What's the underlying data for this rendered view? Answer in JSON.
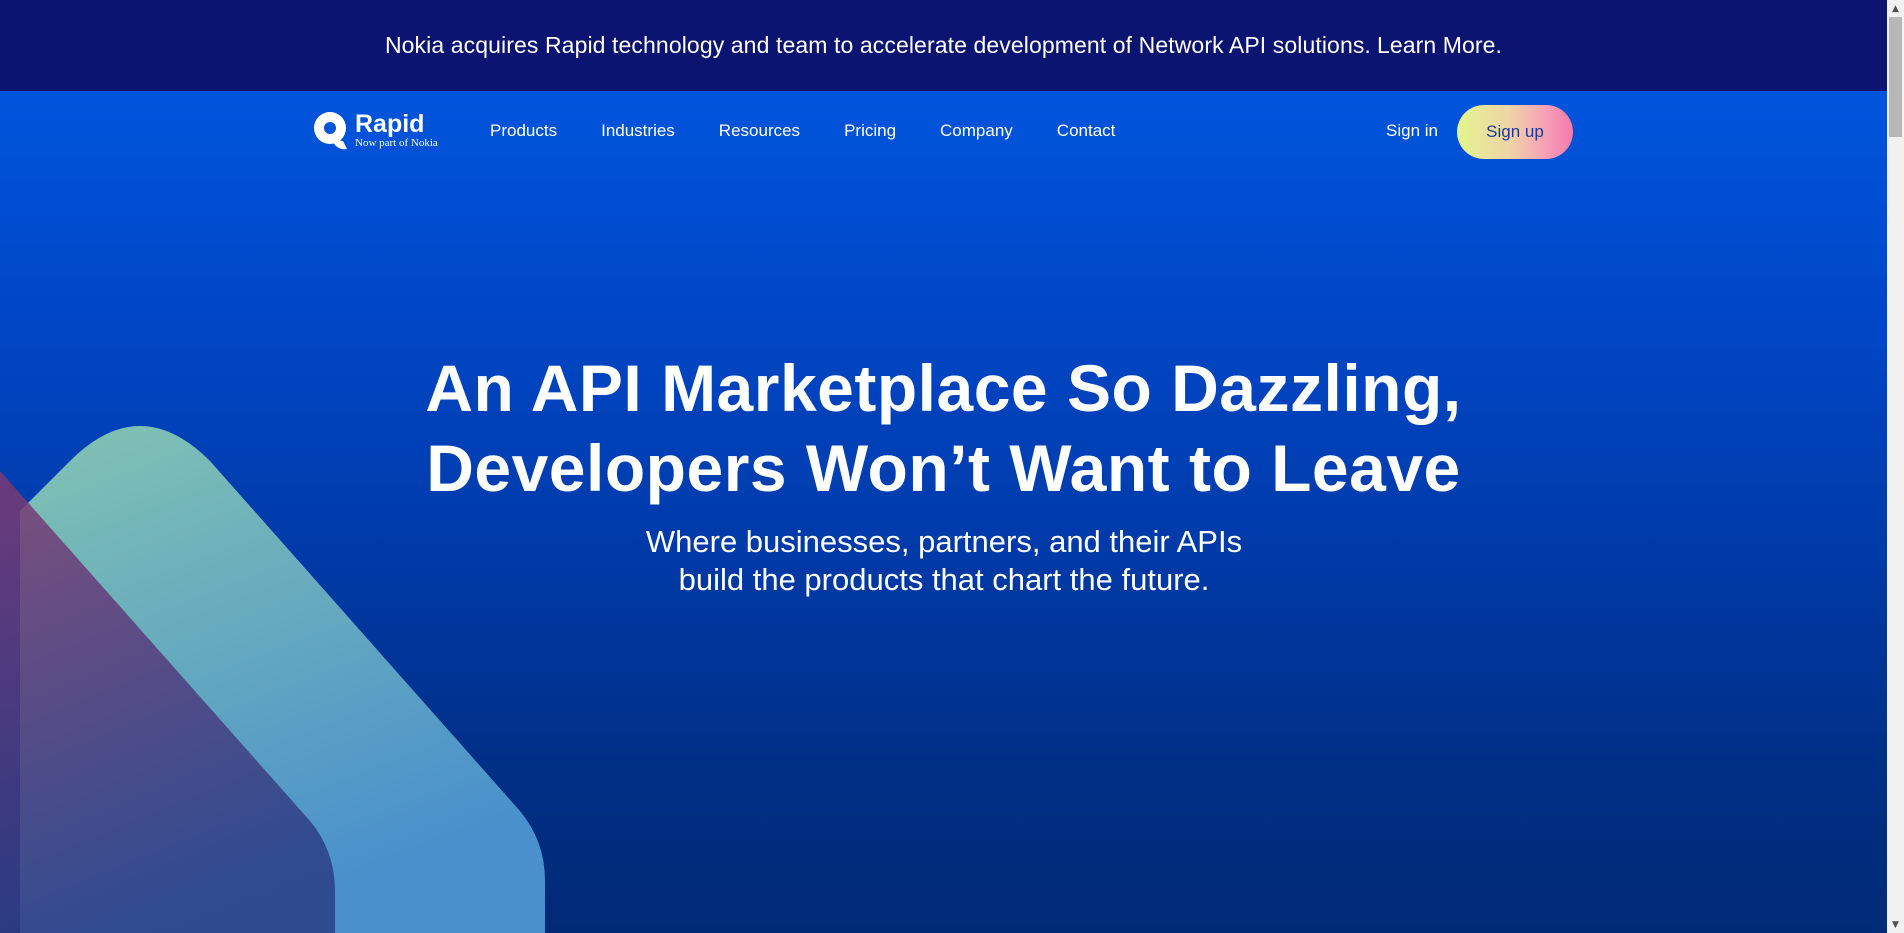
{
  "announcement": {
    "text": "Nokia acquires Rapid technology and team to accelerate development of Network API solutions.",
    "link": "Learn More."
  },
  "logo": {
    "name": "Rapid",
    "tagline": "Now part of Nokia",
    "icon": "rapid-logo-icon"
  },
  "nav": {
    "items": [
      {
        "label": "Products"
      },
      {
        "label": "Industries"
      },
      {
        "label": "Resources"
      },
      {
        "label": "Pricing"
      },
      {
        "label": "Company"
      },
      {
        "label": "Contact"
      }
    ],
    "signin_label": "Sign in",
    "signup_label": "Sign up"
  },
  "hero": {
    "headline_pre": "An",
    "headline_bold": "API Marketplace",
    "headline_post": "So Dazzling,",
    "headline_line2": "Developers Won’t Want to Leave",
    "subhead": "Where businesses, partners, and their APIs build the products that chart the future."
  },
  "colors": {
    "announcement_bg": "#0c1472",
    "hero_top": "#0055dc",
    "hero_bottom": "#012a76",
    "signup_gradient": [
      "#e2f58e",
      "#f79ab8"
    ],
    "teal_shape": "#7fc2b4",
    "magenta_shape": "#7a3a74"
  }
}
